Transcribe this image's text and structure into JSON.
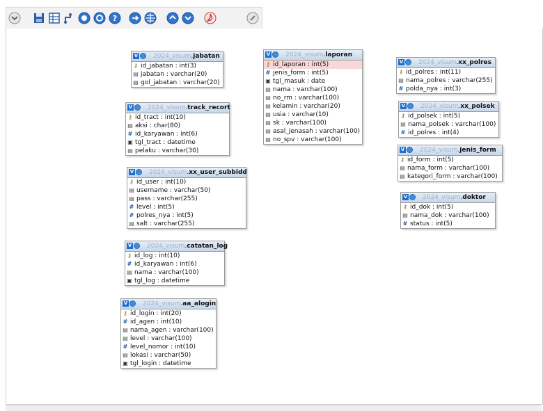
{
  "toolbar": {
    "buttons": [
      {
        "name": "collapse-button",
        "icon": "chevron-circle-icon"
      },
      {
        "name": "save-button",
        "icon": "floppy-disk-icon"
      },
      {
        "name": "table-list-button",
        "icon": "table-icon"
      },
      {
        "name": "angular-links-button",
        "icon": "angle-link-icon"
      },
      {
        "name": "zoom-in-button",
        "icon": "zoom-in-icon"
      },
      {
        "name": "zoom-out-button",
        "icon": "zoom-out-icon"
      },
      {
        "name": "help-button",
        "icon": "help-icon"
      },
      {
        "name": "toggle-relations-button",
        "icon": "relation-icon"
      },
      {
        "name": "toggle-grid-button",
        "icon": "grid-icon"
      },
      {
        "name": "expand-all-button",
        "icon": "expand-icon"
      },
      {
        "name": "collapse-all-button",
        "icon": "collapse-icon"
      },
      {
        "name": "export-pdf-button",
        "icon": "pdf-icon"
      },
      {
        "name": "close-designer-button",
        "icon": "close-circle-icon"
      }
    ]
  },
  "db": "2024_visum",
  "tables": {
    "jabatan": {
      "name": "jabatan",
      "columns": [
        {
          "text": "id_jabatan : int(3)",
          "type": "key"
        },
        {
          "text": "jabatan : varchar(20)",
          "type": "str"
        },
        {
          "text": "gol_jabatan : varchar(20)",
          "type": "str"
        }
      ]
    },
    "track_recort": {
      "name": "track_recort",
      "columns": [
        {
          "text": "id_tract : int(10)",
          "type": "key"
        },
        {
          "text": "aksi : char(80)",
          "type": "str"
        },
        {
          "text": "id_karyawan : int(6)",
          "type": "num"
        },
        {
          "text": "tgl_tract : datetime",
          "type": "date"
        },
        {
          "text": "pelaku : varchar(30)",
          "type": "str"
        }
      ]
    },
    "xx_user_subbidd": {
      "name": "xx_user_subbidd",
      "columns": [
        {
          "text": "id_user : int(10)",
          "type": "key"
        },
        {
          "text": "username : varchar(50)",
          "type": "str"
        },
        {
          "text": "pass : varchar(255)",
          "type": "str"
        },
        {
          "text": "level : int(5)",
          "type": "num"
        },
        {
          "text": "polres_nya : int(5)",
          "type": "num"
        },
        {
          "text": "salt : varchar(255)",
          "type": "str"
        }
      ]
    },
    "catatan_log": {
      "name": "catatan_log",
      "columns": [
        {
          "text": "id_log : int(10)",
          "type": "key"
        },
        {
          "text": "id_karyawan : int(6)",
          "type": "num"
        },
        {
          "text": "nama : varchar(100)",
          "type": "str"
        },
        {
          "text": "tgl_log : datetime",
          "type": "date"
        }
      ]
    },
    "aa_alogin": {
      "name": "aa_alogin",
      "columns": [
        {
          "text": "id_login : int(20)",
          "type": "key"
        },
        {
          "text": "id_agen : int(10)",
          "type": "num"
        },
        {
          "text": "nama_agen : varchar(100)",
          "type": "str"
        },
        {
          "text": "level : varchar(100)",
          "type": "str"
        },
        {
          "text": "level_nomor : int(10)",
          "type": "num"
        },
        {
          "text": "lokasi : varchar(50)",
          "type": "str"
        },
        {
          "text": "tgl_login : datetime",
          "type": "date"
        }
      ]
    },
    "laporan": {
      "name": "laporan",
      "columns": [
        {
          "text": "id_laporan : int(5)",
          "type": "key",
          "highlight": true
        },
        {
          "text": "jenis_form : int(5)",
          "type": "num"
        },
        {
          "text": "tgl_masuk : date",
          "type": "date"
        },
        {
          "text": "nama : varchar(100)",
          "type": "str"
        },
        {
          "text": "no_rm : varchar(100)",
          "type": "str"
        },
        {
          "text": "kelamin : varchar(20)",
          "type": "str"
        },
        {
          "text": "usia : varchar(10)",
          "type": "str"
        },
        {
          "text": "sk : varchar(100)",
          "type": "str"
        },
        {
          "text": "asal_jenasah : varchar(100)",
          "type": "str"
        },
        {
          "text": "no_spv : varchar(100)",
          "type": "str"
        }
      ]
    },
    "xx_polres": {
      "name": "xx_polres",
      "columns": [
        {
          "text": "id_polres : int(11)",
          "type": "key"
        },
        {
          "text": "nama_polres : varchar(255)",
          "type": "str"
        },
        {
          "text": "polda_nya : int(3)",
          "type": "num"
        }
      ]
    },
    "xx_polsek": {
      "name": "xx_polsek",
      "columns": [
        {
          "text": "id_polsek : int(5)",
          "type": "key"
        },
        {
          "text": "nama_polsek : varchar(100)",
          "type": "str"
        },
        {
          "text": "id_polres : int(4)",
          "type": "num"
        }
      ]
    },
    "jenis_form": {
      "name": "jenis_form",
      "columns": [
        {
          "text": "id_form : int(5)",
          "type": "key"
        },
        {
          "text": "nama_form : varchar(100)",
          "type": "str"
        },
        {
          "text": "kategori_form : varchar(100)",
          "type": "str"
        }
      ]
    },
    "doktor": {
      "name": "doktor",
      "columns": [
        {
          "text": "id_dok : int(5)",
          "type": "key"
        },
        {
          "text": "nama_dok : varchar(100)",
          "type": "str"
        },
        {
          "text": "status : int(5)",
          "type": "num"
        }
      ]
    }
  }
}
